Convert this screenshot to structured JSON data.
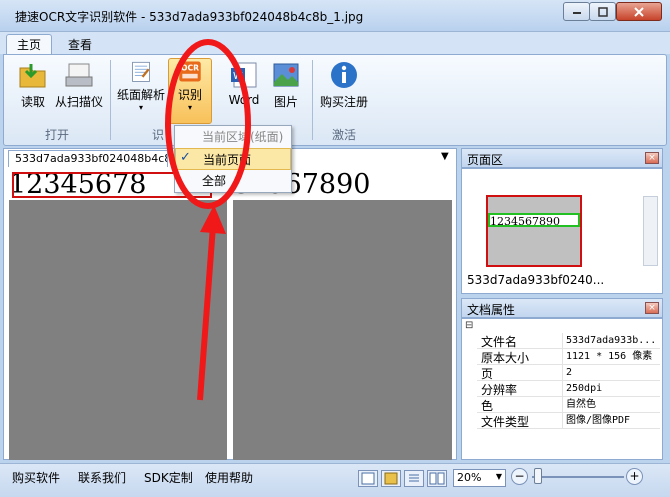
{
  "window": {
    "title": "捷速OCR文字识别软件 - 533d7ada933bf024048b4c8b_1.jpg"
  },
  "tabs": [
    {
      "label": "主页"
    },
    {
      "label": "查看"
    }
  ],
  "ribbon": {
    "read_label": "读取",
    "scanner_label": "从扫描仪",
    "layout_label": "纸面解析",
    "recognize_label": "识别",
    "word_label": "Word",
    "image_label": "图片",
    "buy_label": "购买注册",
    "group_open": "打开",
    "group_recog_fragment": "识",
    "group_activate": "激活"
  },
  "dropdown": {
    "items": [
      {
        "label": "当前区域(纸面)"
      },
      {
        "label": "当前页面",
        "checked": true
      },
      {
        "label": "全部"
      }
    ],
    "check_mark": "✓"
  },
  "document": {
    "tab_label": "533d7ada933bf024048b4c8",
    "left_text": "12345678",
    "right_text": "34567890"
  },
  "page_panel": {
    "title": "页面区",
    "thumb_text": "1234567890",
    "caption": "533d7ada933bf0240..."
  },
  "props_panel": {
    "title": "文档属性",
    "collapse_glyph": "⊟",
    "rows": [
      {
        "key": "文件名",
        "value": "533d7ada933b..."
      },
      {
        "key": "原本大小",
        "value": "1121 * 156 像素"
      },
      {
        "key": "页",
        "value": "2"
      },
      {
        "key": "分辨率",
        "value": "250dpi"
      },
      {
        "key": "色",
        "value": "自然色"
      },
      {
        "key": "文件类型",
        "value": "图像/图像PDF"
      }
    ]
  },
  "statusbar": {
    "links": [
      {
        "label": "购买软件"
      },
      {
        "label": "联系我们"
      },
      {
        "label": "SDK定制"
      },
      {
        "label": "使用帮助"
      }
    ],
    "zoom_value": "20%"
  },
  "colors": {
    "accent_red": "#d01010",
    "ribbon_bg": "#dbe7f5",
    "highlight": "#fbe7a6"
  }
}
